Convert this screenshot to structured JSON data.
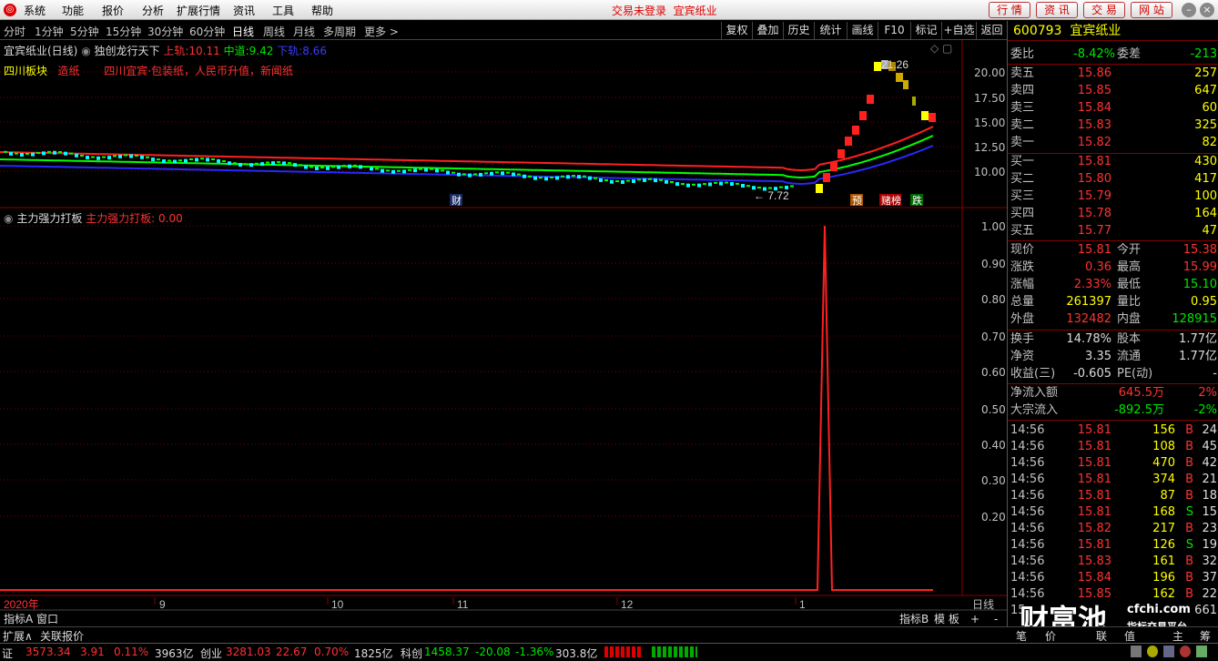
{
  "menu": {
    "items": [
      "系统",
      "功能",
      "报价",
      "分析",
      "扩展行情",
      "资讯",
      "工具",
      "帮助"
    ],
    "status": "交易未登录",
    "stock": "宜宾纸业",
    "right_buttons": [
      "行 情",
      "资 讯",
      "交 易",
      "网 站"
    ]
  },
  "periods": [
    "分时",
    "1分钟",
    "5分钟",
    "15分钟",
    "30分钟",
    "60分钟",
    "日线",
    "周线",
    "月线",
    "多周期",
    "更多 >"
  ],
  "toolbar": [
    "复权",
    "叠加",
    "历史",
    "统计",
    "画线",
    "F10",
    "标记",
    "+自选",
    "返回"
  ],
  "main_chart": {
    "title": "宜宾纸业(日线)",
    "indicator": "独创龙行天下",
    "upper_label": "上轨:",
    "upper_value": "10.11",
    "mid_label": "中道:",
    "mid_value": "9.42",
    "lower_label": "下轨:",
    "lower_value": "8.66",
    "sector": "四川板块",
    "tag1": "造纸",
    "tag2": "四川宜宾·包装纸，人民币升值，新闻纸",
    "y_ticks": [
      "20.00",
      "17.50",
      "15.00",
      "12.50",
      "10.00"
    ],
    "high_marker": "21.26",
    "low_marker": "← 7.72",
    "badges": [
      "财",
      "预",
      "赌榜",
      "跌"
    ]
  },
  "sub_chart": {
    "title": "主力强力打板",
    "label": "主力强力打板:",
    "value": "0.00",
    "y_ticks": [
      "1.00",
      "0.90",
      "0.80",
      "0.70",
      "0.60",
      "0.50",
      "0.40",
      "0.30",
      "0.20"
    ]
  },
  "x_axis": {
    "labels": [
      "2020年",
      "9",
      "10",
      "11",
      "12",
      "1"
    ],
    "period": "日线"
  },
  "colors": {
    "upper": "#ff2020",
    "mid": "#00ff00",
    "lower": "#2020ff",
    "spike": "#ff2020"
  },
  "chart_data": {
    "type": "line",
    "series": [
      {
        "name": "主力强力打板",
        "values": [
          0,
          0,
          0,
          0,
          0,
          0,
          0,
          0,
          0,
          1,
          0,
          0,
          0,
          0,
          0,
          0,
          0,
          0,
          0,
          0
        ]
      }
    ],
    "ylim": [
      0,
      1
    ]
  },
  "quote": {
    "code": "600793",
    "name": "宜宾纸业",
    "webi": {
      "label": "委比",
      "value": "-8.42%",
      "label2": "委差",
      "value2": "-213"
    },
    "asks": [
      {
        "label": "卖五",
        "price": "15.86",
        "vol": "257"
      },
      {
        "label": "卖四",
        "price": "15.85",
        "vol": "647"
      },
      {
        "label": "卖三",
        "price": "15.84",
        "vol": "60"
      },
      {
        "label": "卖二",
        "price": "15.83",
        "vol": "325"
      },
      {
        "label": "卖一",
        "price": "15.82",
        "vol": "82"
      }
    ],
    "bids": [
      {
        "label": "买一",
        "price": "15.81",
        "vol": "430"
      },
      {
        "label": "买二",
        "price": "15.80",
        "vol": "417"
      },
      {
        "label": "买三",
        "price": "15.79",
        "vol": "100"
      },
      {
        "label": "买四",
        "price": "15.78",
        "vol": "164"
      },
      {
        "label": "买五",
        "price": "15.77",
        "vol": "47"
      }
    ],
    "stats": [
      {
        "l1": "现价",
        "v1": "15.81",
        "l2": "今开",
        "v2": "15.38"
      },
      {
        "l1": "涨跌",
        "v1": "0.36",
        "l2": "最高",
        "v2": "15.99"
      },
      {
        "l1": "涨幅",
        "v1": "2.33%",
        "l2": "最低",
        "v2": "15.10"
      },
      {
        "l1": "总量",
        "v1": "261397",
        "l2": "量比",
        "v2": "0.95"
      },
      {
        "l1": "外盘",
        "v1": "132482",
        "l2": "内盘",
        "v2": "128915"
      }
    ],
    "stats2": [
      {
        "l1": "换手",
        "v1": "14.78%",
        "l2": "股本",
        "v2": "1.77亿"
      },
      {
        "l1": "净资",
        "v1": "3.35",
        "l2": "流通",
        "v2": "1.77亿"
      },
      {
        "l1": "收益(三)",
        "v1": "-0.605",
        "l2": "PE(动)",
        "v2": "-"
      }
    ],
    "flows": [
      {
        "label": "净流入额",
        "value": "645.5万",
        "pct": "2%"
      },
      {
        "label": "大宗流入",
        "value": "-892.5万",
        "pct": "-2%"
      }
    ],
    "ticks": [
      {
        "t": "14:56",
        "p": "15.81",
        "v": "156",
        "bs": "B",
        "n": "24"
      },
      {
        "t": "14:56",
        "p": "15.81",
        "v": "108",
        "bs": "B",
        "n": "45"
      },
      {
        "t": "14:56",
        "p": "15.81",
        "v": "470",
        "bs": "B",
        "n": "42"
      },
      {
        "t": "14:56",
        "p": "15.81",
        "v": "374",
        "bs": "B",
        "n": "21"
      },
      {
        "t": "14:56",
        "p": "15.81",
        "v": "87",
        "bs": "B",
        "n": "18"
      },
      {
        "t": "14:56",
        "p": "15.81",
        "v": "168",
        "bs": "S",
        "n": "15"
      },
      {
        "t": "14:56",
        "p": "15.82",
        "v": "217",
        "bs": "B",
        "n": "23"
      },
      {
        "t": "14:56",
        "p": "15.81",
        "v": "126",
        "bs": "S",
        "n": "19"
      },
      {
        "t": "14:56",
        "p": "15.83",
        "v": "161",
        "bs": "B",
        "n": "32"
      },
      {
        "t": "14:56",
        "p": "15.84",
        "v": "196",
        "bs": "B",
        "n": "37"
      },
      {
        "t": "14:56",
        "p": "15.85",
        "v": "162",
        "bs": "B",
        "n": "22"
      },
      {
        "t": "15",
        "p": "",
        "v": "",
        "bs": "",
        "n": "661"
      }
    ]
  },
  "bottom": {
    "tabs": [
      "指标A",
      "窗口"
    ],
    "tabs2": [
      "扩展∧",
      "关联报价"
    ],
    "right_tabs": [
      "指标B",
      "模 板",
      "+",
      "-"
    ],
    "right_tabs2": [
      "笔",
      "价",
      "联",
      "值",
      "主",
      "筹"
    ]
  },
  "status": {
    "sh_label": "证",
    "sh_val": "3573.34",
    "sh_chg": "3.91",
    "sh_pct": "0.11%",
    "sh_amt": "3963亿",
    "cy_label": "创业",
    "cy_val": "3281.03",
    "cy_chg": "22.67",
    "cy_pct": "0.70%",
    "cy_amt": "1825亿",
    "kc_label": "科创",
    "kc_val": "1458.37",
    "kc_chg": "-20.08",
    "kc_pct": "-1.36%",
    "kc_amt": "303.8亿"
  },
  "watermark": {
    "brand": "财富池",
    "url": "cfchi.com",
    "slogan": "指标交易平台"
  }
}
